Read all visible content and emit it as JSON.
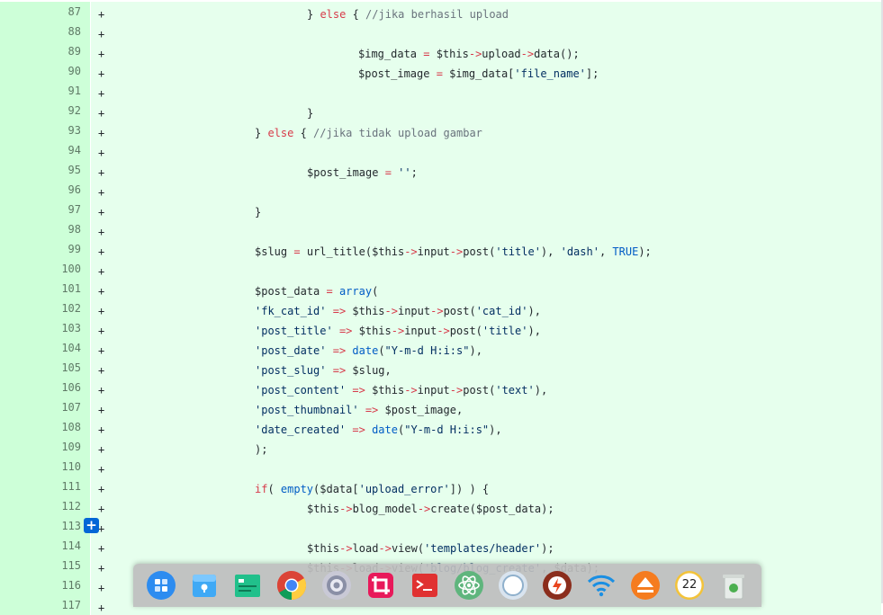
{
  "diff_lines": [
    {
      "num": "87",
      "sign": "+",
      "indent": 341,
      "parts": [
        [
          "}",
          "p"
        ],
        [
          " else ",
          "k"
        ],
        [
          "{ ",
          "p"
        ],
        [
          "//jika berhasil upload",
          "c"
        ]
      ]
    },
    {
      "num": "88",
      "sign": "+",
      "indent": 0,
      "parts": []
    },
    {
      "num": "89",
      "sign": "+",
      "indent": 398,
      "parts": [
        [
          "$img_data ",
          "p"
        ],
        [
          "=",
          "k"
        ],
        [
          " $this",
          "p"
        ],
        [
          "->",
          "k"
        ],
        [
          "upload",
          "p"
        ],
        [
          "->",
          "k"
        ],
        [
          "data();",
          "p"
        ]
      ]
    },
    {
      "num": "90",
      "sign": "+",
      "indent": 398,
      "parts": [
        [
          "$post_image ",
          "p"
        ],
        [
          "=",
          "k"
        ],
        [
          " $img_data[",
          "p"
        ],
        [
          "'file_name'",
          "s"
        ],
        [
          "];",
          "p"
        ]
      ]
    },
    {
      "num": "91",
      "sign": "+",
      "indent": 0,
      "parts": []
    },
    {
      "num": "92",
      "sign": "+",
      "indent": 341,
      "parts": [
        [
          "}",
          "p"
        ]
      ]
    },
    {
      "num": "93",
      "sign": "+",
      "indent": 283,
      "parts": [
        [
          "} ",
          "p"
        ],
        [
          "else",
          "k"
        ],
        [
          " { ",
          "p"
        ],
        [
          "//jika tidak upload gambar",
          "c"
        ]
      ]
    },
    {
      "num": "94",
      "sign": "+",
      "indent": 0,
      "parts": []
    },
    {
      "num": "95",
      "sign": "+",
      "indent": 341,
      "parts": [
        [
          "$post_image ",
          "p"
        ],
        [
          "=",
          "k"
        ],
        [
          " ",
          "p"
        ],
        [
          "''",
          "s"
        ],
        [
          ";",
          "p"
        ]
      ]
    },
    {
      "num": "96",
      "sign": "+",
      "indent": 0,
      "parts": []
    },
    {
      "num": "97",
      "sign": "+",
      "indent": 283,
      "parts": [
        [
          "}",
          "p"
        ]
      ]
    },
    {
      "num": "98",
      "sign": "+",
      "indent": 0,
      "parts": []
    },
    {
      "num": "99",
      "sign": "+",
      "indent": 283,
      "parts": [
        [
          "$slug ",
          "p"
        ],
        [
          "=",
          "k"
        ],
        [
          " url_title($this",
          "p"
        ],
        [
          "->",
          "k"
        ],
        [
          "input",
          "p"
        ],
        [
          "->",
          "k"
        ],
        [
          "post(",
          "p"
        ],
        [
          "'title'",
          "s"
        ],
        [
          "), ",
          "p"
        ],
        [
          "'dash'",
          "s"
        ],
        [
          ", ",
          "p"
        ],
        [
          "TRUE",
          "f"
        ],
        [
          ");",
          "p"
        ]
      ]
    },
    {
      "num": "100",
      "sign": "+",
      "indent": 0,
      "parts": []
    },
    {
      "num": "101",
      "sign": "+",
      "indent": 283,
      "parts": [
        [
          "$post_data ",
          "p"
        ],
        [
          "=",
          "k"
        ],
        [
          " ",
          "p"
        ],
        [
          "array",
          "f"
        ],
        [
          "(",
          "p"
        ]
      ]
    },
    {
      "num": "102",
      "sign": "+",
      "indent": 283,
      "parts": [
        [
          "'fk_cat_id'",
          "s"
        ],
        [
          " ",
          "p"
        ],
        [
          "=>",
          "k"
        ],
        [
          " $this",
          "p"
        ],
        [
          "->",
          "k"
        ],
        [
          "input",
          "p"
        ],
        [
          "->",
          "k"
        ],
        [
          "post(",
          "p"
        ],
        [
          "'cat_id'",
          "s"
        ],
        [
          "),",
          "p"
        ]
      ]
    },
    {
      "num": "103",
      "sign": "+",
      "indent": 283,
      "parts": [
        [
          "'post_title'",
          "s"
        ],
        [
          " ",
          "p"
        ],
        [
          "=>",
          "k"
        ],
        [
          " $this",
          "p"
        ],
        [
          "->",
          "k"
        ],
        [
          "input",
          "p"
        ],
        [
          "->",
          "k"
        ],
        [
          "post(",
          "p"
        ],
        [
          "'title'",
          "s"
        ],
        [
          "),",
          "p"
        ]
      ]
    },
    {
      "num": "104",
      "sign": "+",
      "indent": 283,
      "parts": [
        [
          "'post_date'",
          "s"
        ],
        [
          " ",
          "p"
        ],
        [
          "=>",
          "k"
        ],
        [
          " ",
          "p"
        ],
        [
          "date",
          "f"
        ],
        [
          "(",
          "p"
        ],
        [
          "\"Y-m-d H:i:s\"",
          "s"
        ],
        [
          "),",
          "p"
        ]
      ]
    },
    {
      "num": "105",
      "sign": "+",
      "indent": 283,
      "parts": [
        [
          "'post_slug'",
          "s"
        ],
        [
          " ",
          "p"
        ],
        [
          "=>",
          "k"
        ],
        [
          " $slug,",
          "p"
        ]
      ]
    },
    {
      "num": "106",
      "sign": "+",
      "indent": 283,
      "parts": [
        [
          "'post_content'",
          "s"
        ],
        [
          " ",
          "p"
        ],
        [
          "=>",
          "k"
        ],
        [
          " $this",
          "p"
        ],
        [
          "->",
          "k"
        ],
        [
          "input",
          "p"
        ],
        [
          "->",
          "k"
        ],
        [
          "post(",
          "p"
        ],
        [
          "'text'",
          "s"
        ],
        [
          "),",
          "p"
        ]
      ]
    },
    {
      "num": "107",
      "sign": "+",
      "indent": 283,
      "parts": [
        [
          "'post_thumbnail'",
          "s"
        ],
        [
          " ",
          "p"
        ],
        [
          "=>",
          "k"
        ],
        [
          " $post_image,",
          "p"
        ]
      ]
    },
    {
      "num": "108",
      "sign": "+",
      "indent": 283,
      "parts": [
        [
          "'date_created'",
          "s"
        ],
        [
          " ",
          "p"
        ],
        [
          "=>",
          "k"
        ],
        [
          " ",
          "p"
        ],
        [
          "date",
          "f"
        ],
        [
          "(",
          "p"
        ],
        [
          "\"Y-m-d H:i:s\"",
          "s"
        ],
        [
          "),",
          "p"
        ]
      ]
    },
    {
      "num": "109",
      "sign": "+",
      "indent": 283,
      "parts": [
        [
          ");",
          "p"
        ]
      ]
    },
    {
      "num": "110",
      "sign": "+",
      "indent": 0,
      "parts": []
    },
    {
      "num": "111",
      "sign": "+",
      "indent": 283,
      "parts": [
        [
          "if",
          "k"
        ],
        [
          "( ",
          "p"
        ],
        [
          "empty",
          "f"
        ],
        [
          "($data[",
          "p"
        ],
        [
          "'upload_error'",
          "s"
        ],
        [
          "]) ) {",
          "p"
        ]
      ]
    },
    {
      "num": "112",
      "sign": "+",
      "indent": 341,
      "parts": [
        [
          "$this",
          "p"
        ],
        [
          "->",
          "k"
        ],
        [
          "blog_model",
          "p"
        ],
        [
          "->",
          "k"
        ],
        [
          "create($post_data);",
          "p"
        ]
      ]
    },
    {
      "num": "113",
      "sign": "+",
      "indent": 0,
      "parts": []
    },
    {
      "num": "114",
      "sign": "+",
      "indent": 341,
      "parts": [
        [
          "$this",
          "p"
        ],
        [
          "->",
          "k"
        ],
        [
          "load",
          "p"
        ],
        [
          "->",
          "k"
        ],
        [
          "view(",
          "p"
        ],
        [
          "'templates/header'",
          "s"
        ],
        [
          ");",
          "p"
        ]
      ]
    },
    {
      "num": "115",
      "sign": "+",
      "indent": 341,
      "parts": [
        [
          "$this",
          "p"
        ],
        [
          "->",
          "k"
        ],
        [
          "load",
          "p"
        ],
        [
          "->",
          "k"
        ],
        [
          "view(",
          "p"
        ],
        [
          "'blog/blog_create'",
          "s"
        ],
        [
          ", $data);",
          "p"
        ]
      ]
    },
    {
      "num": "116",
      "sign": "+",
      "indent": 0,
      "parts": []
    },
    {
      "num": "117",
      "sign": "+",
      "indent": 0,
      "parts": []
    }
  ],
  "add_comment_symbol": "+",
  "dock": {
    "items": [
      {
        "name": "launcher-icon"
      },
      {
        "name": "file-manager-icon"
      },
      {
        "name": "terminal-folder-icon"
      },
      {
        "name": "chrome-icon"
      },
      {
        "name": "settings-icon"
      },
      {
        "name": "crop-tool-icon"
      },
      {
        "name": "terminal-icon"
      },
      {
        "name": "atom-icon"
      },
      {
        "name": "circle-app-icon"
      },
      {
        "name": "flash-app-icon"
      },
      {
        "name": "wifi-icon"
      },
      {
        "name": "eject-icon"
      },
      {
        "name": "clock-icon",
        "text": "22"
      },
      {
        "name": "trash-icon"
      }
    ]
  }
}
